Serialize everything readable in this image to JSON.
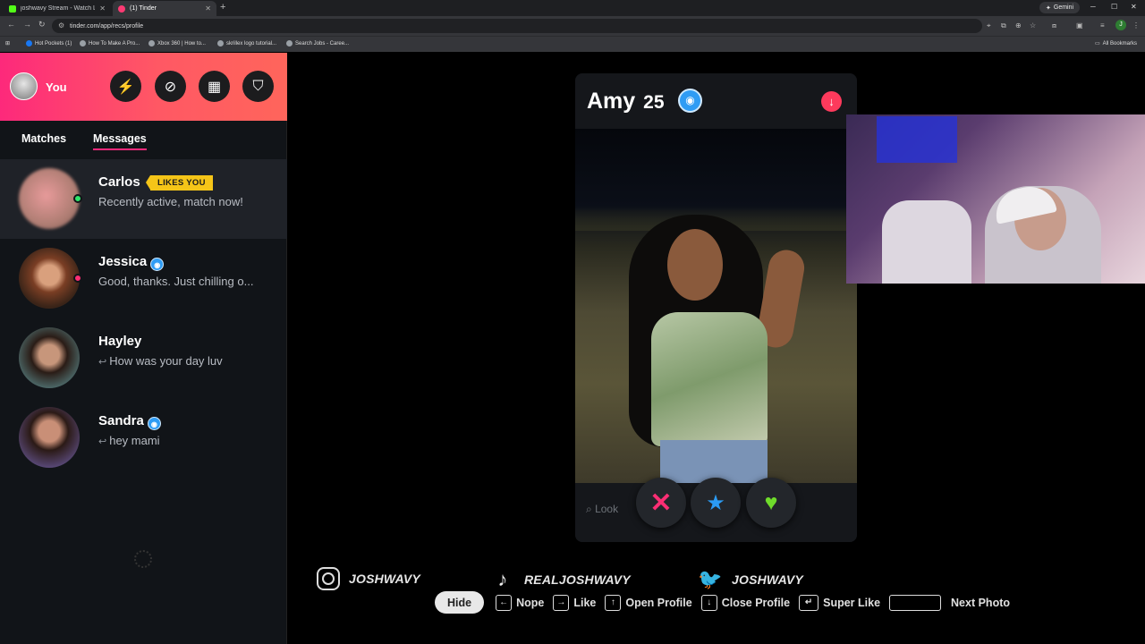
{
  "browser": {
    "tabs": [
      {
        "title": "joshwavy Stream - Watch Live v",
        "favicon_color": "#53fc18"
      },
      {
        "title": "(1) Tinder",
        "favicon_color": "#fd3a73"
      }
    ],
    "new_tab": "+",
    "gemini_label": "Gemini",
    "url": "tinder.com/app/recs/profile",
    "bookmarks": [
      "Hot Pockets (1)",
      "How To Make A Pro...",
      "Xbox 360 | How to...",
      "skrillex logo tutorial...",
      "Search Jobs - Caree..."
    ],
    "all_bookmarks": "All Bookmarks",
    "profile_initial": "J"
  },
  "sidebar": {
    "me_label": "You",
    "header_buttons": [
      "boost-icon",
      "explore-icon",
      "work-icon",
      "safety-shield-icon"
    ],
    "tabs": {
      "matches": "Matches",
      "messages": "Messages"
    },
    "conversations": [
      {
        "name": "Carlos",
        "badge": "LIKES YOU",
        "message": "Recently active, match now!",
        "online_color": "#2ee66b",
        "verified": false,
        "replied": false
      },
      {
        "name": "Jessica",
        "message": "Good, thanks. Just chilling o...",
        "online_color": "#fd2e74",
        "verified": true,
        "replied": false
      },
      {
        "name": "Hayley",
        "message": "How was your day luv",
        "verified": false,
        "replied": true
      },
      {
        "name": "Sandra",
        "message": "hey mami",
        "verified": true,
        "replied": true
      }
    ],
    "reply_glyph": "↩"
  },
  "profile": {
    "name": "Amy",
    "age": "25",
    "search_placeholder": "Look",
    "actions": {
      "nope": "✕",
      "super_like": "★",
      "like": "♥"
    }
  },
  "stream_overlay": {
    "socials": [
      {
        "platform": "instagram",
        "handle": "JOSHWAVY"
      },
      {
        "platform": "tiktok",
        "handle": "REALJOSHWAVY"
      },
      {
        "platform": "twitter",
        "handle": "JOSHWAVY"
      }
    ],
    "hide_label": "Hide",
    "shortcuts": [
      {
        "key": "←",
        "label": "Nope"
      },
      {
        "key": "→",
        "label": "Like"
      },
      {
        "key": "↑",
        "label": "Open Profile"
      },
      {
        "key": "↓",
        "label": "Close Profile"
      },
      {
        "key": "↵",
        "label": "Super Like"
      },
      {
        "key": "",
        "label": "Next Photo"
      }
    ]
  },
  "colors": {
    "brand_gradient_start": "#fd297b",
    "brand_gradient_end": "#ff655b",
    "verified_blue": "#2f9cf4",
    "likes_you_gold": "#f5c518"
  }
}
